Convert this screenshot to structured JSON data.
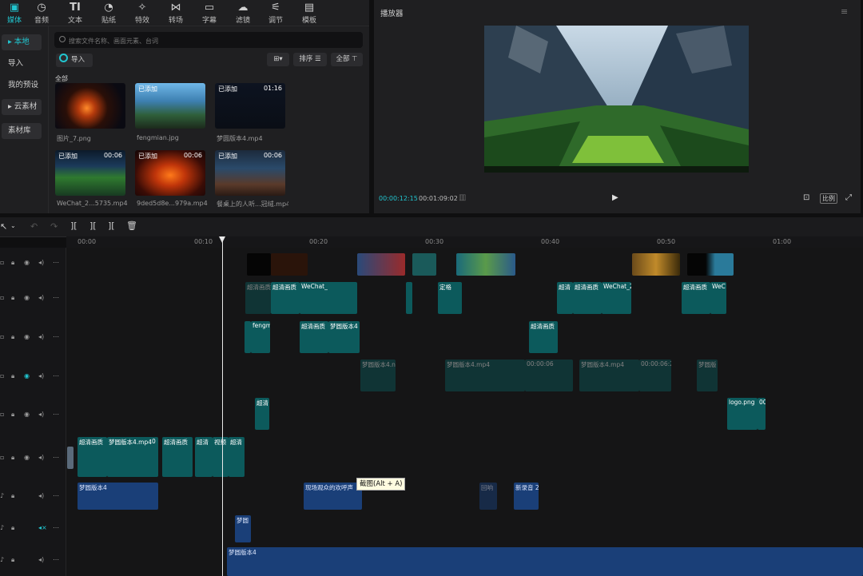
{
  "toolbar": {
    "tools": [
      {
        "label": "媒体",
        "icon": "media-icon"
      },
      {
        "label": "音频",
        "icon": "audio-icon"
      },
      {
        "label": "文本",
        "icon": "text-icon"
      },
      {
        "label": "贴纸",
        "icon": "sticker-icon"
      },
      {
        "label": "特效",
        "icon": "effects-icon"
      },
      {
        "label": "转场",
        "icon": "transition-icon"
      },
      {
        "label": "字幕",
        "icon": "subtitle-icon"
      },
      {
        "label": "滤镜",
        "icon": "filter-icon"
      },
      {
        "label": "调节",
        "icon": "adjust-icon"
      },
      {
        "label": "模板",
        "icon": "template-icon"
      }
    ]
  },
  "side_nav": {
    "items": [
      {
        "label": "本地"
      },
      {
        "label": "导入"
      },
      {
        "label": "我的预设"
      },
      {
        "label": "云素材"
      },
      {
        "label": "素材库"
      }
    ]
  },
  "search": {
    "placeholder": "搜索文件名称、画面元素、台词"
  },
  "media": {
    "import_label": "导入",
    "sort_label": "排序",
    "all_filter_label": "全部",
    "section_label": "全部",
    "items": [
      {
        "caption": "图片_7.png",
        "badge": "",
        "duration": ""
      },
      {
        "caption": "fengmian.jpg",
        "badge": "已添加",
        "duration": ""
      },
      {
        "caption": "梦圆版本4.mp4",
        "badge": "已添加",
        "duration": "01:16"
      },
      {
        "caption": "WeChat_2...5735.mp4",
        "badge": "已添加",
        "duration": "00:06"
      },
      {
        "caption": "9ded5d8e...979a.mp4",
        "badge": "已添加",
        "duration": "00:06"
      },
      {
        "caption": "餐桌上的人听...冠绒.mp4",
        "badge": "已添加",
        "duration": "00:06"
      }
    ]
  },
  "player": {
    "title": "播放器",
    "current_time": "00:00:12:15",
    "total_time": "00:01:09:02",
    "ratio_label": "比例"
  },
  "timeline": {
    "ruler": [
      "00:00",
      "00:10",
      "00:20",
      "00:30",
      "00:40",
      "00:50",
      "01:00"
    ],
    "tooltip": "截图(Alt + A)",
    "clip_labels": {
      "r2a": "超清画质",
      "r2b": "超清画质",
      "r2c": "WeChat_",
      "r2d": "定格",
      "r2e": "超清",
      "r2f": "超清画质",
      "r2g": "WeChat_2",
      "r2h": "超清画质",
      "r2i": "WeC",
      "r3a": "fengm",
      "r3b": "超清画质",
      "r3c": "梦圆版本4",
      "r3d": "超清画质",
      "r4a": "梦圆版本4.n",
      "r4b": "梦圆版本4.mp4",
      "r4c": "00:00:06",
      "r4d": "梦圆版本4.mp4",
      "r4e": "00:00:06:2",
      "r4f": "梦圆版",
      "r5a": "超清",
      "r5b": "logo.png",
      "r5c": "00",
      "r6a": "超清画质",
      "r6b": "梦圆版本4.mp4",
      "r6c": "0",
      "r6d": "超清画质",
      "r6e": "超清",
      "r6f": "视频",
      "r6g": "超清",
      "a1": "梦圆版本4",
      "a2": "现场观众的欢呼声",
      "a3": "回响",
      "a4": "新录音 2",
      "a5": "梦圆",
      "a6": "梦圆版本4"
    }
  }
}
